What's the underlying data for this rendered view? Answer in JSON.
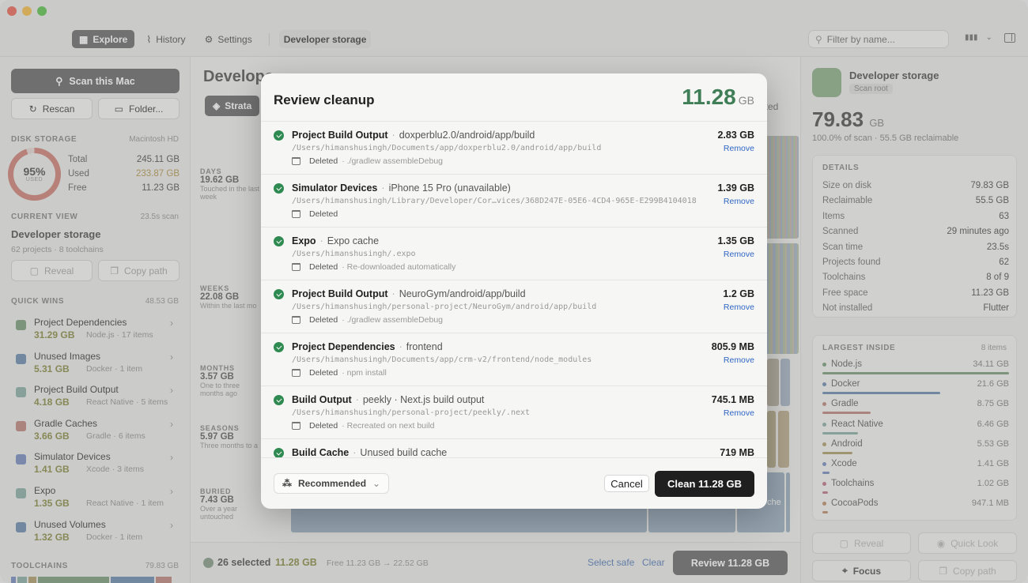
{
  "toolbar": {
    "explore": "Explore",
    "history": "History",
    "settings": "Settings",
    "crumb": "Developer storage",
    "search_placeholder": "Filter by name..."
  },
  "sidebar": {
    "scan_label": "Scan this Mac",
    "rescan_label": "Rescan",
    "folder_label": "Folder...",
    "disk_section": "Disk Storage",
    "disk_name": "Macintosh HD",
    "gauge_pct": "95%",
    "gauge_sub": "USED",
    "gauge_fraction": 0.95,
    "total_label": "Total",
    "total_value": "245.11 GB",
    "used_label": "Used",
    "used_value": "233.87 GB",
    "free_label": "Free",
    "free_value": "11.23 GB",
    "current_view_label": "Current View",
    "current_view_time": "23.5s scan",
    "current_view_title": "Developer storage",
    "current_view_sub": "62 projects · 8 toolchains",
    "reveal_label": "Reveal",
    "copy_path_label": "Copy path",
    "quick_wins_label": "Quick Wins",
    "quick_wins_total": "48.53 GB",
    "quick_wins": [
      {
        "title": "Project Dependencies",
        "size": "31.29 GB",
        "meta": "Node.js · 17 items",
        "color": "#7fa07f"
      },
      {
        "title": "Unused Images",
        "size": "5.31 GB",
        "meta": "Docker · 1 item",
        "color": "#6f8fb0"
      },
      {
        "title": "Project Build Output",
        "size": "4.18 GB",
        "meta": "React Native · 5 items",
        "color": "#8fb0a8"
      },
      {
        "title": "Gradle Caches",
        "size": "3.66 GB",
        "meta": "Gradle · 6 items",
        "color": "#c08a80"
      },
      {
        "title": "Simulator Devices",
        "size": "1.41 GB",
        "meta": "Xcode · 3 items",
        "color": "#7a8fc0"
      },
      {
        "title": "Expo",
        "size": "1.35 GB",
        "meta": "React Native · 1 item",
        "color": "#8fb0a8"
      },
      {
        "title": "Unused Volumes",
        "size": "1.32 GB",
        "meta": "Docker · 1 item",
        "color": "#6f8fb0"
      }
    ],
    "toolchains_label": "Toolchains",
    "toolchains_total": "79.83 GB"
  },
  "center": {
    "title": "Develope",
    "strata_label": "Strata",
    "selected_suffix": "ected",
    "bands": [
      {
        "name": "DAYS",
        "size": "19.62 GB",
        "desc": "Touched in the last week"
      },
      {
        "name": "WEEKS",
        "size": "22.08 GB",
        "desc": "Within the last mo"
      },
      {
        "name": "MONTHS",
        "size": "3.57 GB",
        "desc": "One to three months ago"
      },
      {
        "name": "SEASONS",
        "size": "5.97 GB",
        "desc": "Three months to a"
      },
      {
        "name": "BURIED",
        "size": "7.43 GB",
        "desc": "Over a year untouched"
      }
    ],
    "block_label": "che",
    "selected_count": "26 selected",
    "selected_size": "11.28 GB",
    "free_change": "Free 11.23 GB → 22.52 GB",
    "select_safe": "Select safe",
    "clear": "Clear",
    "review_label": "Review 11.28 GB"
  },
  "inspector": {
    "title": "Developer storage",
    "badge": "Scan root",
    "big_value": "79.83",
    "big_unit": "GB",
    "sub": "100.0% of scan · 55.5 GB reclaimable",
    "details_label": "Details",
    "details": [
      {
        "k": "Size on disk",
        "v": "79.83 GB"
      },
      {
        "k": "Reclaimable",
        "v": "55.5 GB"
      },
      {
        "k": "Items",
        "v": "63"
      },
      {
        "k": "Scanned",
        "v": "29 minutes ago"
      },
      {
        "k": "Scan time",
        "v": "23.5s"
      },
      {
        "k": "Projects found",
        "v": "62"
      },
      {
        "k": "Toolchains",
        "v": "8 of 9"
      },
      {
        "k": "Free space",
        "v": "11.23 GB"
      },
      {
        "k": "Not installed",
        "v": "Flutter"
      }
    ],
    "largest_label": "Largest Inside",
    "largest_count": "8 items",
    "largest": [
      {
        "name": "Node.js",
        "size": "34.11 GB",
        "color": "#7fa07f",
        "fraction": 1.0
      },
      {
        "name": "Docker",
        "size": "21.6 GB",
        "color": "#6f8fb0",
        "fraction": 0.63
      },
      {
        "name": "Gradle",
        "size": "8.75 GB",
        "color": "#c08a80",
        "fraction": 0.26
      },
      {
        "name": "React Native",
        "size": "6.46 GB",
        "color": "#8fb0a8",
        "fraction": 0.19
      },
      {
        "name": "Android",
        "size": "5.53 GB",
        "color": "#b0a070",
        "fraction": 0.16
      },
      {
        "name": "Xcode",
        "size": "1.41 GB",
        "color": "#7a8fc0",
        "fraction": 0.04
      },
      {
        "name": "Toolchains",
        "size": "1.02 GB",
        "color": "#c07a8a",
        "fraction": 0.03
      },
      {
        "name": "CocoaPods",
        "size": "947.1 MB",
        "color": "#c09070",
        "fraction": 0.03
      }
    ],
    "reveal_label": "Reveal",
    "quicklook_label": "Quick Look",
    "focus_label": "Focus",
    "copy_path_label": "Copy path"
  },
  "modal": {
    "title": "Review cleanup",
    "total_value": "11.28",
    "total_unit": "GB",
    "items": [
      {
        "name": "Project Build Output",
        "detail": "doxperblu2.0/android/app/build",
        "path": "/Users/himanshusingh/Documents/app/doxperblu2.0/android/app/build",
        "status": "Deleted",
        "note": "· ./gradlew assembleDebug",
        "size": "2.83 GB",
        "remove": "Remove"
      },
      {
        "name": "Simulator Devices",
        "detail": "iPhone 15 Pro (unavailable)",
        "path": "/Users/himanshusingh/Library/Developer/Cor…vices/368D247E-05E6-4CD4-965E-E299B4104018",
        "status": "Deleted",
        "note": "",
        "size": "1.39 GB",
        "remove": "Remove"
      },
      {
        "name": "Expo",
        "detail": "Expo cache",
        "path": "/Users/himanshusingh/.expo",
        "status": "Deleted",
        "note": "· Re-downloaded automatically",
        "size": "1.35 GB",
        "remove": "Remove"
      },
      {
        "name": "Project Build Output",
        "detail": "NeuroGym/android/app/build",
        "path": "/Users/himanshusingh/personal-project/NeuroGym/android/app/build",
        "status": "Deleted",
        "note": "· ./gradlew assembleDebug",
        "size": "1.2 GB",
        "remove": "Remove"
      },
      {
        "name": "Project Dependencies",
        "detail": "frontend",
        "path": "/Users/himanshusingh/Documents/app/crm-v2/frontend/node_modules",
        "status": "Deleted",
        "note": "· npm install",
        "size": "805.9 MB",
        "remove": "Remove"
      },
      {
        "name": "Build Output",
        "detail": "peekly · Next.js build output",
        "path": "/Users/himanshusingh/personal-project/peekly/.next",
        "status": "Deleted",
        "note": "· Recreated on next build",
        "size": "745.1 MB",
        "remove": "Remove"
      },
      {
        "name": "Build Cache",
        "detail": "Unused build cache",
        "path": "",
        "status": "",
        "note": "",
        "size": "719 MB",
        "remove": ""
      }
    ],
    "filter_label": "Recommended",
    "cancel_label": "Cancel",
    "clean_label": "Clean 11.28 GB"
  }
}
